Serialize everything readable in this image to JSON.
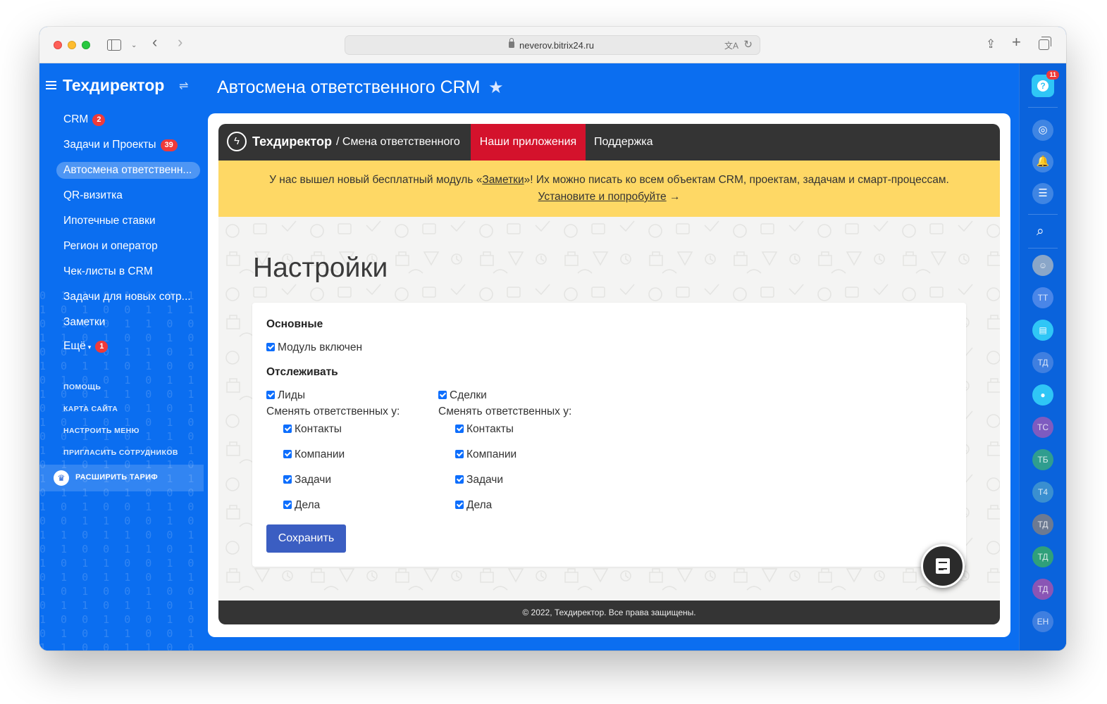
{
  "browser": {
    "url": "neverov.bitrix24.ru"
  },
  "sidebar": {
    "brand": "Техдиректор",
    "items": [
      {
        "label": "CRM",
        "counter": "2"
      },
      {
        "label": "Задачи и Проекты",
        "counter": "39"
      },
      {
        "label": "Автосмена ответственн..."
      },
      {
        "label": "QR-визитка"
      },
      {
        "label": "Ипотечные ставки"
      },
      {
        "label": "Регион и оператор"
      },
      {
        "label": "Чек-листы в CRM"
      },
      {
        "label": "Задачи для новых сотр..."
      },
      {
        "label": "Заметки"
      },
      {
        "label": "Ещё",
        "counter": "1"
      }
    ],
    "links": [
      "ПОМОЩЬ",
      "КАРТА САЙТА",
      "НАСТРОИТЬ МЕНЮ",
      "ПРИГЛАСИТЬ СОТРУДНИКОВ"
    ],
    "upgrade": "РАСШИРИТЬ ТАРИФ"
  },
  "header": {
    "title": "Автосмена ответственного CRM"
  },
  "right_panel": {
    "help_count": "11",
    "avatars": [
      "ТТ",
      "ТД",
      "ТС",
      "ТБ",
      "Т4",
      "ТД",
      "ТД",
      "ТД",
      "ЕН"
    ],
    "avatar_colors": [
      "#4a86e8",
      "#3f7fe0",
      "#7e5bc0",
      "#2f9d8f",
      "#3a8fd0",
      "#6c7a92",
      "#2fa07a",
      "#8a55b5",
      "#3f7fe0"
    ]
  },
  "app": {
    "brand": "Техдиректор",
    "brand_sub": "/ Смена ответственного",
    "nav_apps": "Наши приложения",
    "nav_support": "Поддержка",
    "notice_text_1": "У нас вышел новый бесплатный модуль «",
    "notice_link": "Заметки",
    "notice_text_2": "»! Их можно писать ко всем объектам CRM, проектам, задачам и смарт-процессам.",
    "notice_cta": "Установите и попробуйте",
    "notice_arrow": "→",
    "settings_title": "Настройки",
    "section_main": "Основные",
    "module_enabled": "Модуль включен",
    "section_track": "Отслеживать",
    "leads": "Лиды",
    "deals": "Сделки",
    "change_for": "Сменять ответственных у:",
    "sub_items": [
      "Контакты",
      "Компании",
      "Задачи",
      "Дела"
    ],
    "save": "Сохранить",
    "footer": "© 2022, Техдиректор. Все права защищены."
  },
  "colors": {
    "portal_blue": "#0b6ef0",
    "nav_dark": "#343434",
    "nav_apps_red": "#d4122c",
    "notice_yellow": "#fed865",
    "save_button": "#3b5ec2",
    "checkbox": "#0d6efd"
  }
}
